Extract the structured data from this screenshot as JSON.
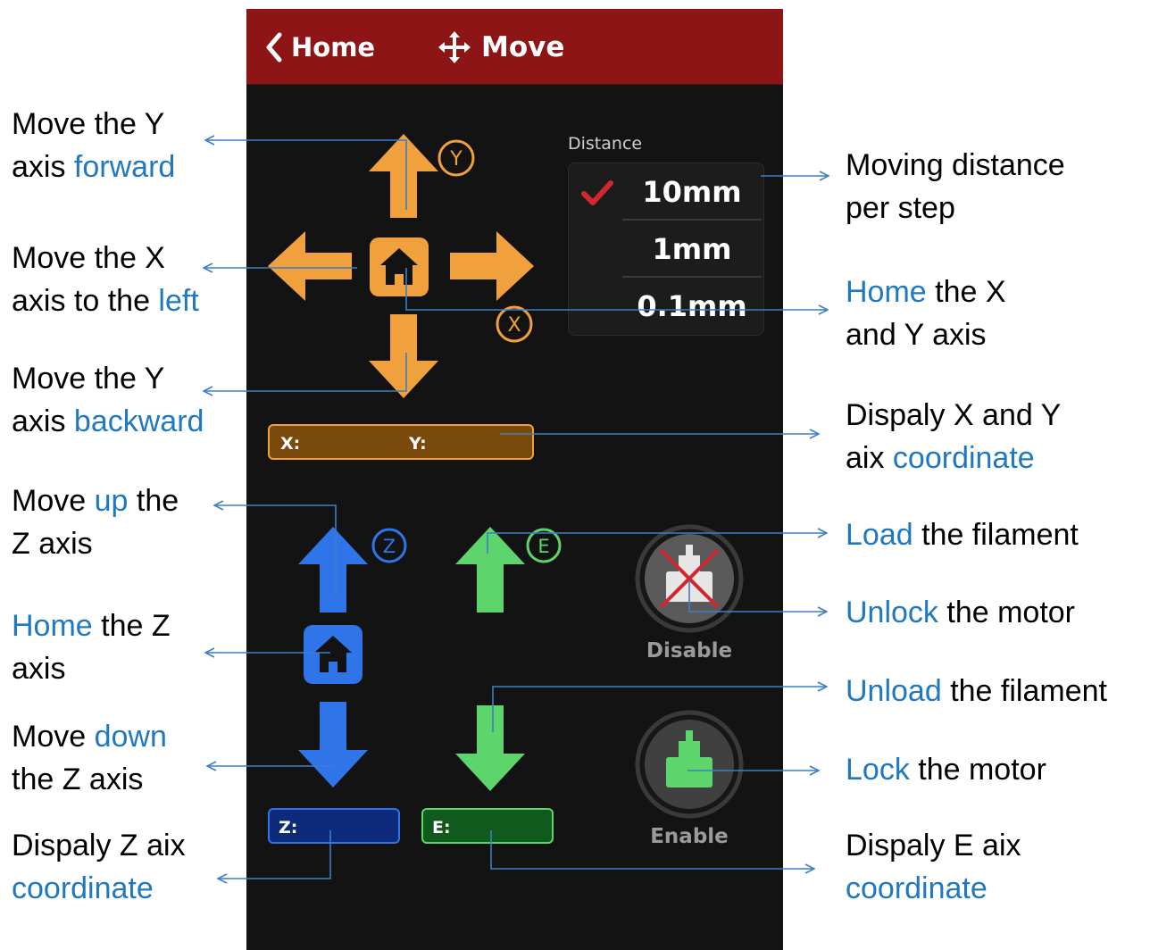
{
  "topbar": {
    "back_label": "Home",
    "title": "Move"
  },
  "distance": {
    "label": "Distance",
    "options": [
      "10mm",
      "1mm",
      "0.1mm"
    ],
    "selected": "10mm"
  },
  "axis_badges": {
    "y": "Y",
    "x": "X",
    "z": "Z",
    "e": "E"
  },
  "coords": {
    "x_label": "X:",
    "y_label": "Y:",
    "z_label": "Z:",
    "e_label": "E:"
  },
  "motor": {
    "disable_label": "Disable",
    "enable_label": "Enable"
  },
  "colors": {
    "xy": "#f0a03c",
    "z": "#2f74e8",
    "e": "#5ed46c",
    "topbar": "#8e1515",
    "callout_line": "#3d7fc4",
    "highlight": "#1f78c0"
  },
  "annotations": {
    "left": [
      {
        "parts": [
          {
            "t": "Move the Y",
            "h": false
          }
        ],
        "parts2": [
          {
            "t": "axis ",
            "h": false
          },
          {
            "t": "forward",
            "h": true
          }
        ]
      },
      {
        "parts": [
          {
            "t": "Move the X",
            "h": false
          }
        ],
        "parts2": [
          {
            "t": "axis to the ",
            "h": false
          },
          {
            "t": "left",
            "h": true
          }
        ]
      },
      {
        "parts": [
          {
            "t": "Move the Y",
            "h": false
          }
        ],
        "parts2": [
          {
            "t": "axis ",
            "h": false
          },
          {
            "t": "backward",
            "h": true
          }
        ]
      },
      {
        "parts": [
          {
            "t": "Move ",
            "h": false
          },
          {
            "t": "up",
            "h": true
          },
          {
            "t": " the",
            "h": false
          }
        ],
        "parts2": [
          {
            "t": "Z axis",
            "h": false
          }
        ]
      },
      {
        "parts": [
          {
            "t": "Home",
            "h": true
          },
          {
            "t": " the Z",
            "h": false
          }
        ],
        "parts2": [
          {
            "t": "axis",
            "h": false
          }
        ]
      },
      {
        "parts": [
          {
            "t": "Move ",
            "h": false
          },
          {
            "t": "down",
            "h": true
          }
        ],
        "parts2": [
          {
            "t": "the Z axis",
            "h": false
          }
        ]
      },
      {
        "parts": [
          {
            "t": "Dispaly Z aix",
            "h": false
          }
        ],
        "parts2": [
          {
            "t": "coordinate",
            "h": true
          }
        ]
      }
    ],
    "right": [
      {
        "parts": [
          {
            "t": "Moving distance",
            "h": false
          }
        ],
        "parts2": [
          {
            "t": "per step",
            "h": false
          }
        ]
      },
      {
        "parts": [
          {
            "t": "Home",
            "h": true
          },
          {
            "t": " the X",
            "h": false
          }
        ],
        "parts2": [
          {
            "t": "and Y axis",
            "h": false
          }
        ]
      },
      {
        "parts": [
          {
            "t": "Dispaly X and Y",
            "h": false
          }
        ],
        "parts2": [
          {
            "t": "aix ",
            "h": false
          },
          {
            "t": "coordinate",
            "h": true
          }
        ]
      },
      {
        "parts": [
          {
            "t": "Load",
            "h": true
          },
          {
            "t": " the filament",
            "h": false
          }
        ],
        "parts2": []
      },
      {
        "parts": [
          {
            "t": "Unlock",
            "h": true
          },
          {
            "t": " the motor",
            "h": false
          }
        ],
        "parts2": []
      },
      {
        "parts": [
          {
            "t": "Unload",
            "h": true
          },
          {
            "t": " the filament",
            "h": false
          }
        ],
        "parts2": []
      },
      {
        "parts": [
          {
            "t": "Lock",
            "h": true
          },
          {
            "t": " the motor",
            "h": false
          }
        ],
        "parts2": []
      },
      {
        "parts": [
          {
            "t": "Dispaly E aix",
            "h": false
          }
        ],
        "parts2": [
          {
            "t": "coordinate",
            "h": true
          }
        ]
      }
    ]
  }
}
